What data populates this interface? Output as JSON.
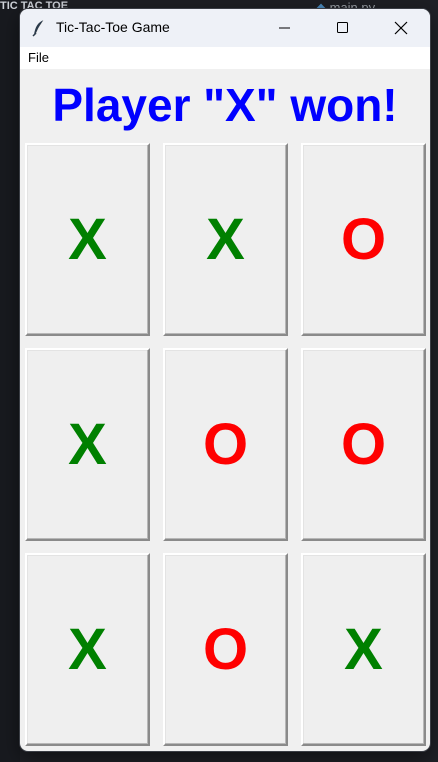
{
  "background": {
    "explorer_title": "TIC TAC TOE",
    "editor_tab": "main.py"
  },
  "window": {
    "title": "Tic-Tac-Toe Game",
    "icon": "feather-icon",
    "controls": {
      "minimize": "minimize-icon",
      "maximize": "maximize-icon",
      "close": "close-icon"
    }
  },
  "menu": {
    "file_label": "File"
  },
  "game": {
    "status_text": "Player \"X\" won!",
    "status_color": "#0000ff",
    "x_color": "#008000",
    "o_color": "#ff0000",
    "board": [
      [
        "X",
        "X",
        "O"
      ],
      [
        "X",
        "O",
        "O"
      ],
      [
        "X",
        "O",
        "X"
      ]
    ]
  }
}
